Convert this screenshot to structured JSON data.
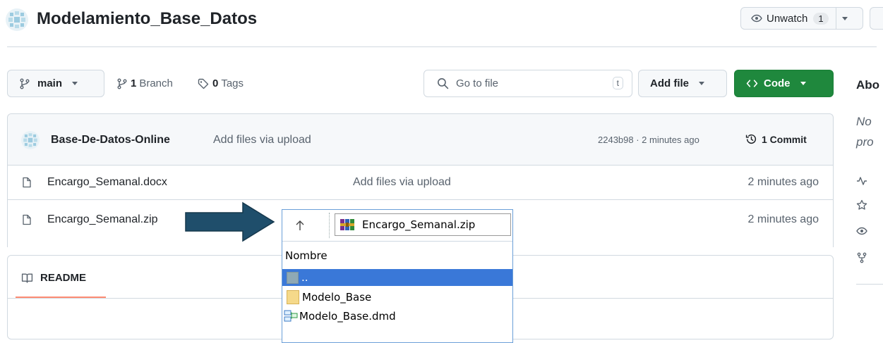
{
  "repo": {
    "name": "Modelamiento_Base_Datos",
    "unwatch_label": "Unwatch",
    "unwatch_count": "1"
  },
  "toolbar": {
    "branch_name": "main",
    "branch_count": "1",
    "branch_label": "Branch",
    "tag_count": "0",
    "tag_label": "Tags",
    "search_placeholder": "Go to file",
    "search_shortcut": "t",
    "add_file_label": "Add file",
    "code_label": "Code",
    "code_color": "#1f883d"
  },
  "commit": {
    "author": "Base-De-Datos-Online",
    "message": "Add files via upload",
    "meta": "2243b98 · 2 minutes ago",
    "count_label": "1 Commit"
  },
  "files": [
    {
      "name": "Encargo_Semanal.docx",
      "message": "Add files via upload",
      "time": "2 minutes ago"
    },
    {
      "name": "Encargo_Semanal.zip",
      "message": "",
      "time": "2 minutes ago"
    }
  ],
  "readme": {
    "label": "README"
  },
  "sidebar": {
    "about_label": "Abo",
    "desc_line1": "No",
    "desc_line2": "pro"
  },
  "explorer": {
    "path": "Encargo_Semanal.zip",
    "column_header": "Nombre",
    "items": [
      {
        "name": "..",
        "selected": true,
        "icon": "parent-folder-icon"
      },
      {
        "name": "Modelo_Base",
        "selected": false,
        "icon": "folder-icon"
      },
      {
        "name": "Modelo_Base.dmd",
        "selected": false,
        "icon": "dmd-file-icon"
      }
    ],
    "selection_color": "#3a78d8",
    "border_color": "#6b9fd8"
  },
  "annotation": {
    "arrow_color": "#1f4e6b"
  }
}
